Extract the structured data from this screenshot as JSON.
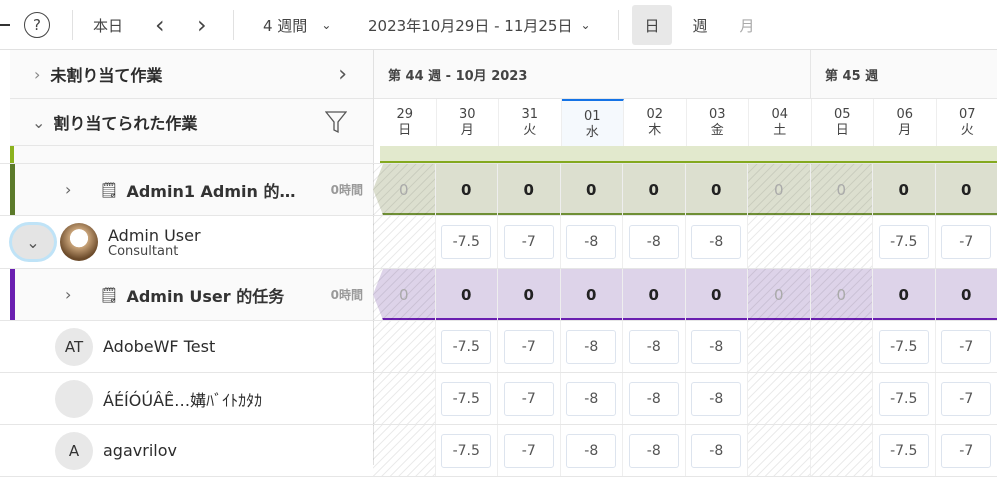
{
  "toolbar": {
    "help": "?",
    "today": "本日",
    "prev": "‹",
    "next": "›",
    "range": "4 週間",
    "dates": "2023年10月29日 - 11月25日",
    "views": [
      "日",
      "週",
      "月"
    ]
  },
  "left": {
    "unassigned": "未割り当て作業",
    "assigned": "割り当てられた作業"
  },
  "weeks": [
    "第 44 週 - 10月 2023",
    "第 45 週"
  ],
  "days": [
    {
      "n": "29",
      "d": "日"
    },
    {
      "n": "30",
      "d": "月"
    },
    {
      "n": "31",
      "d": "火"
    },
    {
      "n": "01",
      "d": "水"
    },
    {
      "n": "02",
      "d": "木"
    },
    {
      "n": "03",
      "d": "金"
    },
    {
      "n": "04",
      "d": "土"
    },
    {
      "n": "05",
      "d": "日"
    },
    {
      "n": "06",
      "d": "月"
    },
    {
      "n": "07",
      "d": "火"
    }
  ],
  "weekend": [
    0,
    6,
    7
  ],
  "rows": [
    {
      "type": "task",
      "name": "Admin1 Admin 的…",
      "hours": "0時間",
      "color": "#5b7a2a",
      "bg": "#dcdfcf",
      "line": "#6f8f35",
      "values": [
        "0",
        "0",
        "0",
        "0",
        "0",
        "0",
        "0",
        "0",
        "0",
        "0"
      ]
    },
    {
      "type": "person",
      "name": "Admin User",
      "role": "Consultant",
      "avatar": "photo",
      "expanded": true,
      "values": [
        "",
        "-7.5",
        "-7",
        "-8",
        "-8",
        "-8",
        "",
        "",
        "-7.5",
        "-7"
      ]
    },
    {
      "type": "task",
      "name": "Admin User 的任务",
      "hours": "0時間",
      "color": "#6a1fb0",
      "bg": "#ddd3e9",
      "line": "#6a1fb0",
      "values": [
        "0",
        "0",
        "0",
        "0",
        "0",
        "0",
        "0",
        "0",
        "0",
        "0"
      ]
    },
    {
      "type": "person",
      "name": "AdobeWF Test",
      "avatar": "AT",
      "values": [
        "",
        "-7.5",
        "-7",
        "-8",
        "-8",
        "-8",
        "",
        "",
        "-7.5",
        "-7"
      ]
    },
    {
      "type": "person",
      "name": "ÁÉÍÓÚÂÊ…媾ﾊﾞｲﾄｶﾀｶ",
      "avatar": "",
      "values": [
        "",
        "-7.5",
        "-7",
        "-8",
        "-8",
        "-8",
        "",
        "",
        "-7.5",
        "-7"
      ]
    },
    {
      "type": "person",
      "name": "agavrilov",
      "avatar": "A",
      "values": [
        "",
        "-7.5",
        "-7",
        "-8",
        "-8",
        "-8",
        "",
        "",
        "-7.5",
        "-7"
      ]
    }
  ]
}
